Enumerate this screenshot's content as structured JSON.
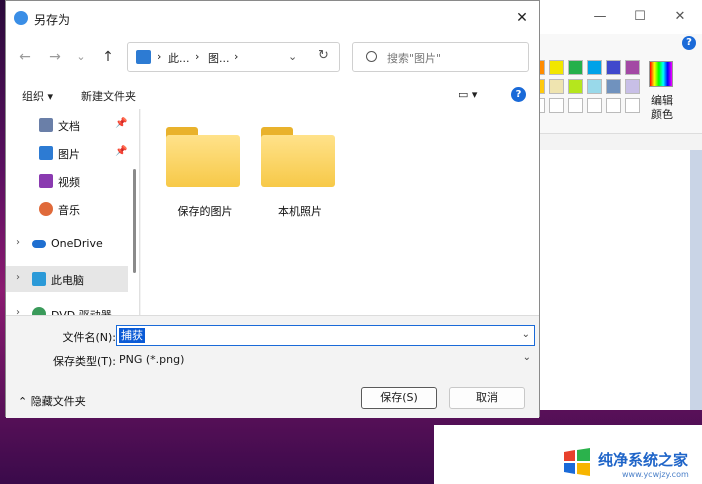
{
  "dialog": {
    "title": "另存为",
    "close_glyph": "✕"
  },
  "nav": {
    "back_glyph": "←",
    "forward_glyph": "→",
    "recent_glyph": "⌄",
    "up_glyph": "↑",
    "path": [
      "此...",
      "图..."
    ],
    "sep": "›",
    "refresh_glyph": "↻",
    "search_placeholder": "搜索\"图片\""
  },
  "toolbar": {
    "organize": "组织 ▾",
    "new_folder": "新建文件夹",
    "view_glyph": "▭ ▾",
    "help": "?"
  },
  "sidebar": {
    "items": [
      {
        "label": "文档",
        "color": "#6a7fa8"
      },
      {
        "label": "图片",
        "color": "#2d7bd3"
      },
      {
        "label": "视频",
        "color": "#8a3ab0"
      },
      {
        "label": "音乐",
        "color": "#e06a3a"
      },
      {
        "label": "OneDrive",
        "color": "#1f6fd0"
      },
      {
        "label": "此电脑",
        "color": "#2b9ad8"
      },
      {
        "label": "DVD 驱动器 (D:",
        "color": "#3a9a5a"
      }
    ],
    "pin_glyph": "📌",
    "chevron_glyph": "›"
  },
  "folders": [
    {
      "label": "保存的图片"
    },
    {
      "label": "本机照片"
    }
  ],
  "form": {
    "filename_label": "文件名(N):",
    "filename_value": "捕获",
    "filetype_label": "保存类型(T):",
    "filetype_value": "PNG (*.png)",
    "dropdown_glyph": "⌄",
    "hide_folders": "隐藏文件夹",
    "hide_glyph": "⌃",
    "save_button": "保存(S)",
    "cancel_button": "取消"
  },
  "paint": {
    "minimize": "—",
    "maximize": "☐",
    "close": "✕",
    "help": "?",
    "edit_colors_1": "编辑",
    "edit_colors_2": "颜色",
    "colors": [
      "#ff8c00",
      "#f2e600",
      "#25b04b",
      "#00a2e8",
      "#3f48cc",
      "#a349a4",
      "#ffc90e",
      "#efe4b0",
      "#b5e61d",
      "#99d9ea",
      "#7092be",
      "#c8bfe7"
    ]
  },
  "watermark": {
    "text": "纯净系统之家",
    "url": "www.ycwjzy.com"
  }
}
